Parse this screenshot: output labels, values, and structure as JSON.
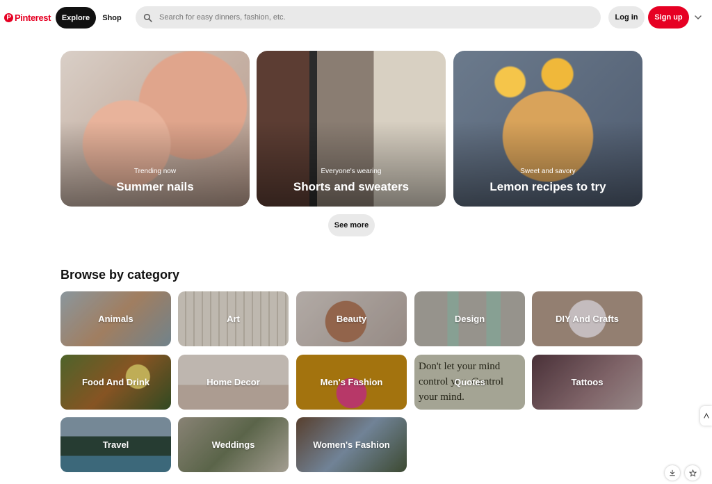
{
  "header": {
    "logo_text": "Pinterest",
    "explore_label": "Explore",
    "shop_label": "Shop",
    "search_placeholder": "Search for easy dinners, fashion, etc.",
    "login_label": "Log in",
    "signup_label": "Sign up",
    "brand_color": "#e60023"
  },
  "hero_cards": [
    {
      "subtitle": "Trending now",
      "title": "Summer nails"
    },
    {
      "subtitle": "Everyone's wearing",
      "title": "Shorts and sweaters"
    },
    {
      "subtitle": "Sweet and savory",
      "title": "Lemon recipes to try"
    }
  ],
  "see_more_label": "See more",
  "browse": {
    "title": "Browse by category",
    "categories": [
      "Animals",
      "Art",
      "Beauty",
      "Design",
      "DIY And Crafts",
      "Food And Drink",
      "Home Decor",
      "Men's Fashion",
      "Quotes",
      "Tattoos",
      "Travel",
      "Weddings",
      "Women's Fashion"
    ]
  },
  "quote_tile_text": "Don't let your mind control you. Control your mind."
}
